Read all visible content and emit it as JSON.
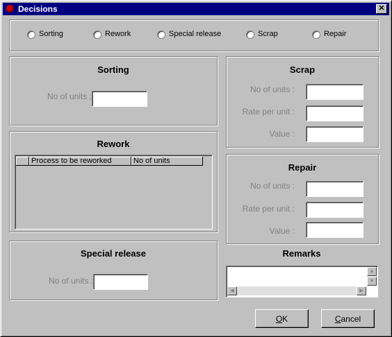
{
  "window": {
    "title": "Decisions",
    "close": "✕"
  },
  "options": [
    "Sorting",
    "Rework",
    "Special release",
    "Scrap",
    "Repair"
  ],
  "sorting": {
    "title": "Sorting",
    "units_label": "No of units :"
  },
  "rework": {
    "title": "Rework",
    "col1": "Process to be reworked",
    "col2": "No of units"
  },
  "special": {
    "title": "Special release",
    "units_label": "No of units :"
  },
  "scrap": {
    "title": "Scrap",
    "units_label": "No of units :",
    "rate_label": "Rate per unit :",
    "value_label": "Value :"
  },
  "repair": {
    "title": "Repair",
    "units_label": "No of units :",
    "rate_label": "Rate per unit :",
    "value_label": "Value :"
  },
  "remarks": {
    "title": "Remarks"
  },
  "buttons": {
    "ok_first": "O",
    "ok_rest": "K",
    "cancel_first": "C",
    "cancel_rest": "ancel"
  }
}
